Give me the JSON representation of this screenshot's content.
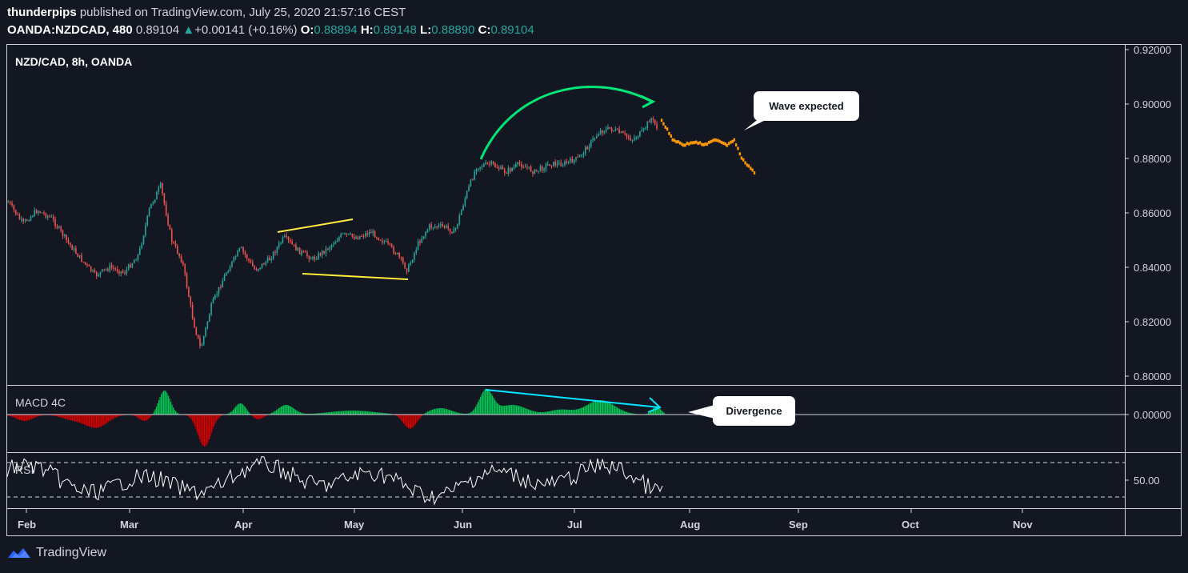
{
  "header": {
    "author": "thunderpips",
    "published_text": "published on TradingView.com, July 25, 2020 21:57:16 CEST",
    "symbol": "OANDA:NZDCAD, 480",
    "last": "0.89104",
    "change": "+0.00141 (+0.16%)",
    "o_label": "O:",
    "o_value": "0.88894",
    "h_label": "H:",
    "h_value": "0.89148",
    "l_label": "L:",
    "l_value": "0.88890",
    "c_label": "C:",
    "c_value": "0.89104"
  },
  "panes": {
    "main_title": "NZD/CAD, 8h, OANDA",
    "macd_title": "MACD 4C",
    "rsi_title": "RSI",
    "price_ticks": [
      "0.92000",
      "0.90000",
      "0.88000",
      "0.86000",
      "0.84000",
      "0.82000",
      "0.80000"
    ],
    "macd_tick": "0.00000",
    "rsi_tick": "50.00",
    "months": [
      "Feb",
      "Mar",
      "Apr",
      "May",
      "Jun",
      "Jul",
      "Aug",
      "Sep",
      "Oct",
      "Nov"
    ]
  },
  "annotations": {
    "wave_label": "Wave expected",
    "divergence_label": "Divergence"
  },
  "footer": {
    "brand": "TradingView"
  },
  "colors": {
    "background": "#131722",
    "up_candle": "#26a69a",
    "down_candle": "#ef5350",
    "projection": "#ff9800",
    "trendline_yellow": "#ffeb3b",
    "arrow_green": "#00e676",
    "divergence_cyan": "#00e5ff",
    "macd_positive": "#00c853",
    "macd_negative": "#d50000",
    "rsi_line": "#ffffff"
  },
  "chart_data": {
    "type": "candlestick",
    "title": "NZD/CAD, 8h, OANDA",
    "ylim": [
      0.8,
      0.92
    ],
    "close_series": [
      {
        "date": "2020-01-27",
        "close": 0.864
      },
      {
        "date": "2020-01-31",
        "close": 0.856
      },
      {
        "date": "2020-02-04",
        "close": 0.861
      },
      {
        "date": "2020-02-08",
        "close": 0.858
      },
      {
        "date": "2020-02-12",
        "close": 0.85
      },
      {
        "date": "2020-02-16",
        "close": 0.843
      },
      {
        "date": "2020-02-20",
        "close": 0.837
      },
      {
        "date": "2020-02-24",
        "close": 0.84
      },
      {
        "date": "2020-02-28",
        "close": 0.838
      },
      {
        "date": "2020-03-03",
        "close": 0.845
      },
      {
        "date": "2020-03-06",
        "close": 0.862
      },
      {
        "date": "2020-03-09",
        "close": 0.87
      },
      {
        "date": "2020-03-12",
        "close": 0.85
      },
      {
        "date": "2020-03-15",
        "close": 0.842
      },
      {
        "date": "2020-03-18",
        "close": 0.82
      },
      {
        "date": "2020-03-20",
        "close": 0.81
      },
      {
        "date": "2020-03-23",
        "close": 0.826
      },
      {
        "date": "2020-03-27",
        "close": 0.838
      },
      {
        "date": "2020-03-31",
        "close": 0.847
      },
      {
        "date": "2020-04-04",
        "close": 0.839
      },
      {
        "date": "2020-04-08",
        "close": 0.843
      },
      {
        "date": "2020-04-12",
        "close": 0.851
      },
      {
        "date": "2020-04-16",
        "close": 0.846
      },
      {
        "date": "2020-04-20",
        "close": 0.843
      },
      {
        "date": "2020-04-24",
        "close": 0.847
      },
      {
        "date": "2020-04-28",
        "close": 0.852
      },
      {
        "date": "2020-05-02",
        "close": 0.851
      },
      {
        "date": "2020-05-06",
        "close": 0.853
      },
      {
        "date": "2020-05-10",
        "close": 0.849
      },
      {
        "date": "2020-05-13",
        "close": 0.845
      },
      {
        "date": "2020-05-16",
        "close": 0.839
      },
      {
        "date": "2020-05-19",
        "close": 0.849
      },
      {
        "date": "2020-05-22",
        "close": 0.855
      },
      {
        "date": "2020-05-26",
        "close": 0.855
      },
      {
        "date": "2020-05-29",
        "close": 0.853
      },
      {
        "date": "2020-06-01",
        "close": 0.866
      },
      {
        "date": "2020-06-04",
        "close": 0.877
      },
      {
        "date": "2020-06-08",
        "close": 0.878
      },
      {
        "date": "2020-06-12",
        "close": 0.875
      },
      {
        "date": "2020-06-16",
        "close": 0.878
      },
      {
        "date": "2020-06-20",
        "close": 0.875
      },
      {
        "date": "2020-06-24",
        "close": 0.878
      },
      {
        "date": "2020-06-28",
        "close": 0.878
      },
      {
        "date": "2020-07-02",
        "close": 0.88
      },
      {
        "date": "2020-07-05",
        "close": 0.885
      },
      {
        "date": "2020-07-08",
        "close": 0.89
      },
      {
        "date": "2020-07-11",
        "close": 0.891
      },
      {
        "date": "2020-07-14",
        "close": 0.889
      },
      {
        "date": "2020-07-17",
        "close": 0.887
      },
      {
        "date": "2020-07-20",
        "close": 0.89
      },
      {
        "date": "2020-07-22",
        "close": 0.895
      },
      {
        "date": "2020-07-24",
        "close": 0.891
      }
    ],
    "projection_series": [
      {
        "date": "2020-07-25",
        "close": 0.894
      },
      {
        "date": "2020-07-28",
        "close": 0.887
      },
      {
        "date": "2020-07-31",
        "close": 0.885
      },
      {
        "date": "2020-08-03",
        "close": 0.886
      },
      {
        "date": "2020-08-06",
        "close": 0.885
      },
      {
        "date": "2020-08-09",
        "close": 0.887
      },
      {
        "date": "2020-08-12",
        "close": 0.885
      },
      {
        "date": "2020-08-14",
        "close": 0.887
      },
      {
        "date": "2020-08-16",
        "close": 0.88
      },
      {
        "date": "2020-08-18",
        "close": 0.877
      },
      {
        "date": "2020-08-20",
        "close": 0.874
      }
    ],
    "rsi_level": 50
  }
}
